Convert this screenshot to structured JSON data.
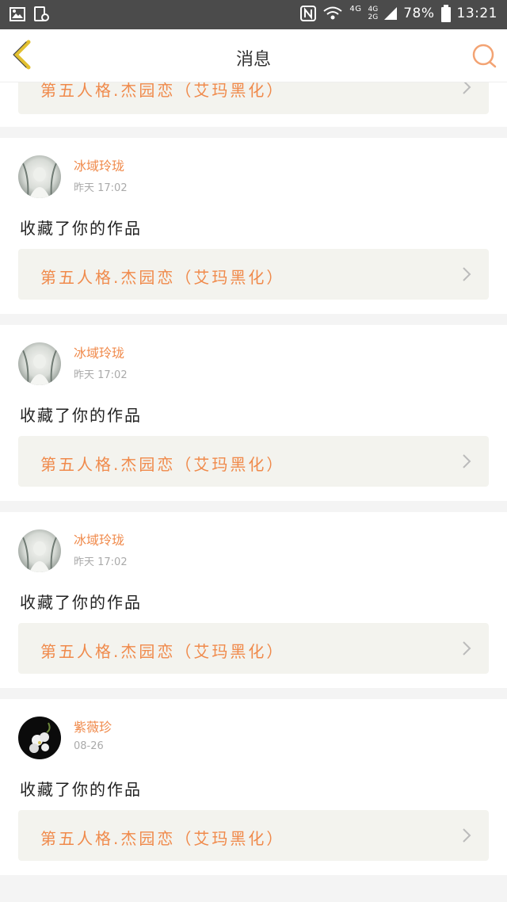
{
  "status_bar": {
    "network": "4G",
    "network2_top": "4G",
    "network2_bottom": "2G",
    "battery": "78%",
    "time": "13:21"
  },
  "header": {
    "title": "消息"
  },
  "partial_item": {
    "work_title": "第五人格.杰园恋（艾玛黑化）"
  },
  "messages": [
    {
      "username": "冰域玲珑",
      "time": "昨天 17:02",
      "action": "收藏了你的作品",
      "work_title": "第五人格.杰园恋（艾玛黑化）"
    },
    {
      "username": "冰域玲珑",
      "time": "昨天 17:02",
      "action": "收藏了你的作品",
      "work_title": "第五人格.杰园恋（艾玛黑化）"
    },
    {
      "username": "冰域玲珑",
      "time": "昨天 17:02",
      "action": "收藏了你的作品",
      "work_title": "第五人格.杰园恋（艾玛黑化）"
    },
    {
      "username": "紫薇珍",
      "time": "08-26",
      "action": "收藏了你的作品",
      "work_title": "第五人格.杰园恋（艾玛黑化）"
    }
  ],
  "colors": {
    "accent": "#f08a4b",
    "back_icon": "#e2c030",
    "search_icon": "#f3a373"
  },
  "icons": {
    "back": "chevron-left-icon",
    "search": "search-icon",
    "chevron": "chevron-right-icon"
  }
}
